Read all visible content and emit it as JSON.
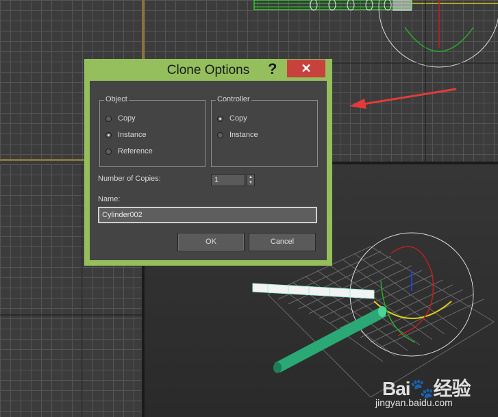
{
  "dialog": {
    "title": "Clone Options",
    "help_glyph": "?",
    "close_glyph": "✕",
    "object_group": {
      "title": "Object",
      "options": [
        {
          "label": "Copy",
          "selected": false
        },
        {
          "label": "Instance",
          "selected": true
        },
        {
          "label": "Reference",
          "selected": false
        }
      ]
    },
    "controller_group": {
      "title": "Controller",
      "options": [
        {
          "label": "Copy",
          "selected": true
        },
        {
          "label": "Instance",
          "selected": false
        }
      ]
    },
    "copies": {
      "label": "Number of Copies:",
      "value": "1"
    },
    "name": {
      "label": "Name:",
      "value": "Cylinder002"
    },
    "ok_label": "OK",
    "cancel_label": "Cancel"
  },
  "watermark": {
    "logo_text": "Bai",
    "logo_suffix": "经验",
    "url": "jingyan.baidu.com"
  },
  "colors": {
    "dialog_frame": "#94bf5c",
    "close": "#c7423d",
    "annotation_arrow": "#e23b3b",
    "cylinder_green": "#2aa875",
    "wire_cyan": "#9ff0e0"
  }
}
